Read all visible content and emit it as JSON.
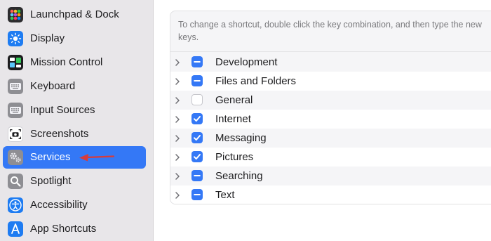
{
  "sidebar": {
    "items": [
      {
        "label": "Launchpad & Dock",
        "icon": "launchpad-icon"
      },
      {
        "label": "Display",
        "icon": "display-icon"
      },
      {
        "label": "Mission Control",
        "icon": "mission-control-icon"
      },
      {
        "label": "Keyboard",
        "icon": "keyboard-icon"
      },
      {
        "label": "Input Sources",
        "icon": "input-sources-icon"
      },
      {
        "label": "Screenshots",
        "icon": "screenshots-icon"
      },
      {
        "label": "Services",
        "icon": "services-icon",
        "selected": true
      },
      {
        "label": "Spotlight",
        "icon": "spotlight-icon"
      },
      {
        "label": "Accessibility",
        "icon": "accessibility-icon"
      },
      {
        "label": "App Shortcuts",
        "icon": "app-shortcuts-icon"
      }
    ]
  },
  "main": {
    "description": "To change a shortcut, double click the key combination, and then type the new keys.",
    "categories": [
      {
        "label": "Development",
        "state": "mixed"
      },
      {
        "label": "Files and Folders",
        "state": "mixed"
      },
      {
        "label": "General",
        "state": "unchecked"
      },
      {
        "label": "Internet",
        "state": "checked"
      },
      {
        "label": "Messaging",
        "state": "checked"
      },
      {
        "label": "Pictures",
        "state": "checked"
      },
      {
        "label": "Searching",
        "state": "mixed"
      },
      {
        "label": "Text",
        "state": "mixed"
      }
    ]
  },
  "colors": {
    "accent": "#3478f6",
    "sidebar_bg": "#e8e6e9",
    "annotation_arrow": "#d63c3c"
  }
}
